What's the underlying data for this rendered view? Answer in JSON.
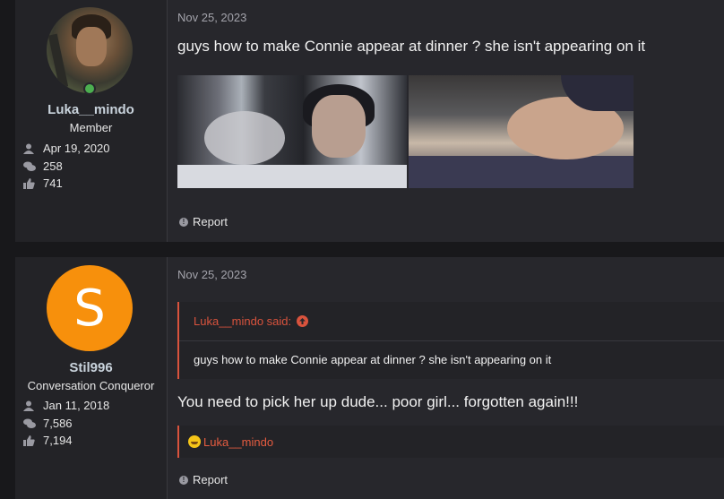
{
  "posts": [
    {
      "user": {
        "name": "Luka__mindo",
        "title": "Member",
        "joined": "Apr 19, 2020",
        "messages": "258",
        "reactions": "741",
        "online": true
      },
      "date": "Nov 25, 2023",
      "message": "guys how to make Connie appear at dinner ? she isn't appearing on it",
      "report_label": "Report"
    },
    {
      "user": {
        "name": "Stil996",
        "title": "Conversation Conqueror",
        "joined": "Jan 11, 2018",
        "messages": "7,586",
        "reactions": "7,194",
        "avatar_letter": "S"
      },
      "date": "Nov 25, 2023",
      "quote": {
        "author": "Luka__mindo said:",
        "text": "guys how to make Connie appear at dinner ? she isn't appearing on it"
      },
      "message": "You need to pick her up dude... poor girl... forgotten again!!!",
      "reaction_user": "Luka__mindo",
      "report_label": "Report"
    }
  ],
  "colors": {
    "accent": "#d9533d",
    "avatar_bg": "#f7900c",
    "online": "#4caf50"
  }
}
